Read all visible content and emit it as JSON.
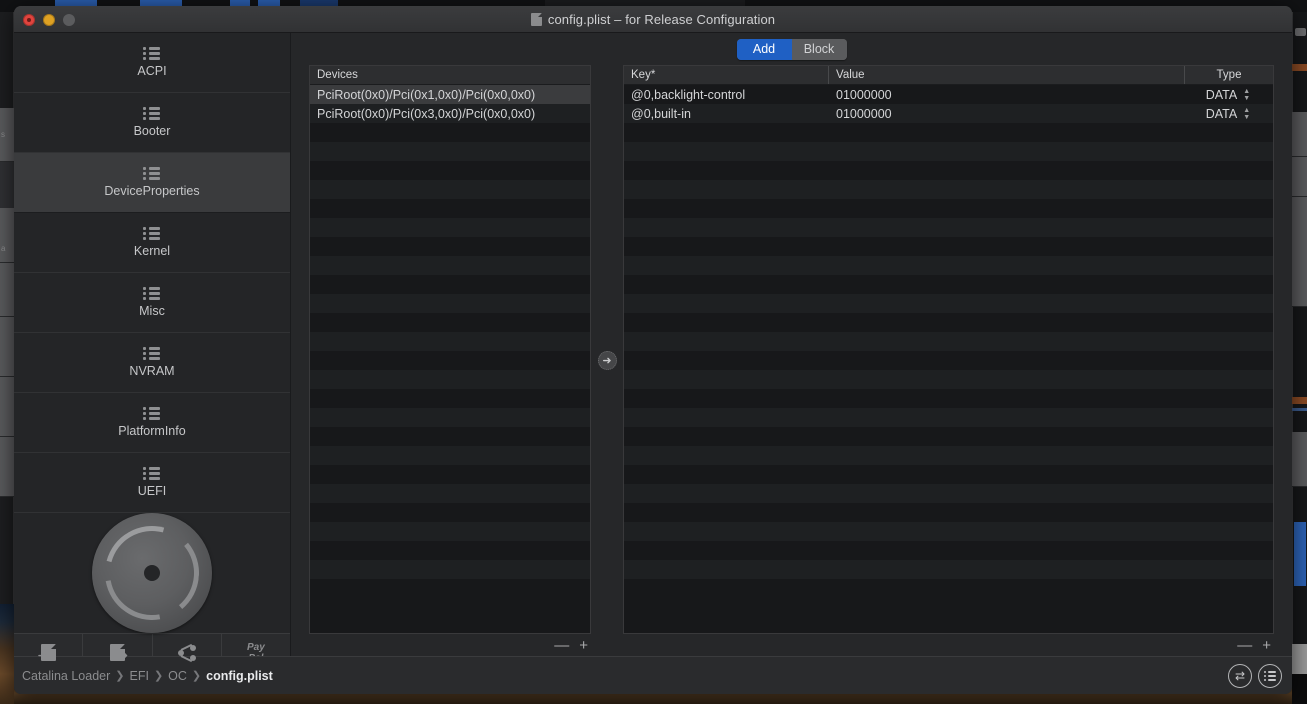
{
  "window": {
    "title": "config.plist – for Release Configuration",
    "doc_icon": "document-icon",
    "traffic_lights": [
      "close-button",
      "minimize-button",
      "zoom-button"
    ]
  },
  "sidebar": {
    "items": [
      {
        "label": "ACPI",
        "icon": "list-icon",
        "active": false
      },
      {
        "label": "Booter",
        "icon": "list-icon",
        "active": false
      },
      {
        "label": "DeviceProperties",
        "icon": "list-icon",
        "active": true
      },
      {
        "label": "Kernel",
        "icon": "list-icon",
        "active": false
      },
      {
        "label": "Misc",
        "icon": "list-icon",
        "active": false
      },
      {
        "label": "NVRAM",
        "icon": "list-icon",
        "active": false
      },
      {
        "label": "PlatformInfo",
        "icon": "list-icon",
        "active": false
      },
      {
        "label": "UEFI",
        "icon": "list-icon",
        "active": false
      }
    ],
    "logo": "opencore-disc-logo",
    "toolbar": [
      {
        "name": "import-button",
        "icon": "document-arrow-in-icon",
        "label": ""
      },
      {
        "name": "export-button",
        "icon": "document-arrow-out-icon",
        "label": ""
      },
      {
        "name": "share-button",
        "icon": "share-icon",
        "label": ""
      },
      {
        "name": "paypal-button",
        "icon": "paypal-icon",
        "label": "Pay Pal"
      }
    ]
  },
  "segmented": {
    "options": [
      "Add",
      "Block"
    ],
    "selected": "Add",
    "selected_color": "#1f60c4"
  },
  "devices_table": {
    "columns": [
      "Devices"
    ],
    "rows": [
      {
        "device": "PciRoot(0x0)/Pci(0x1,0x0)/Pci(0x0,0x0)",
        "selected": true
      },
      {
        "device": "PciRoot(0x0)/Pci(0x3,0x0)/Pci(0x0,0x0)",
        "selected": false
      }
    ],
    "remove_label": "—",
    "add_label": "+"
  },
  "transfer_button": {
    "icon": "arrow-right-icon",
    "label": "➜"
  },
  "properties_table": {
    "columns": [
      "Key*",
      "Value",
      "Type"
    ],
    "rows": [
      {
        "key": "@0,backlight-control",
        "value": "01000000",
        "type": "DATA"
      },
      {
        "key": "@0,built-in",
        "value": "01000000",
        "type": "DATA"
      }
    ],
    "remove_label": "—",
    "add_label": "+"
  },
  "statusbar": {
    "breadcrumb": [
      "Catalina Loader",
      "EFI",
      "OC",
      "config.plist"
    ],
    "separator": "❯",
    "buttons": [
      {
        "name": "toggle-view-button",
        "icon": "swap-arrows-icon",
        "glyph": "⇄"
      },
      {
        "name": "list-view-button",
        "icon": "list-icon",
        "glyph": ""
      }
    ]
  }
}
